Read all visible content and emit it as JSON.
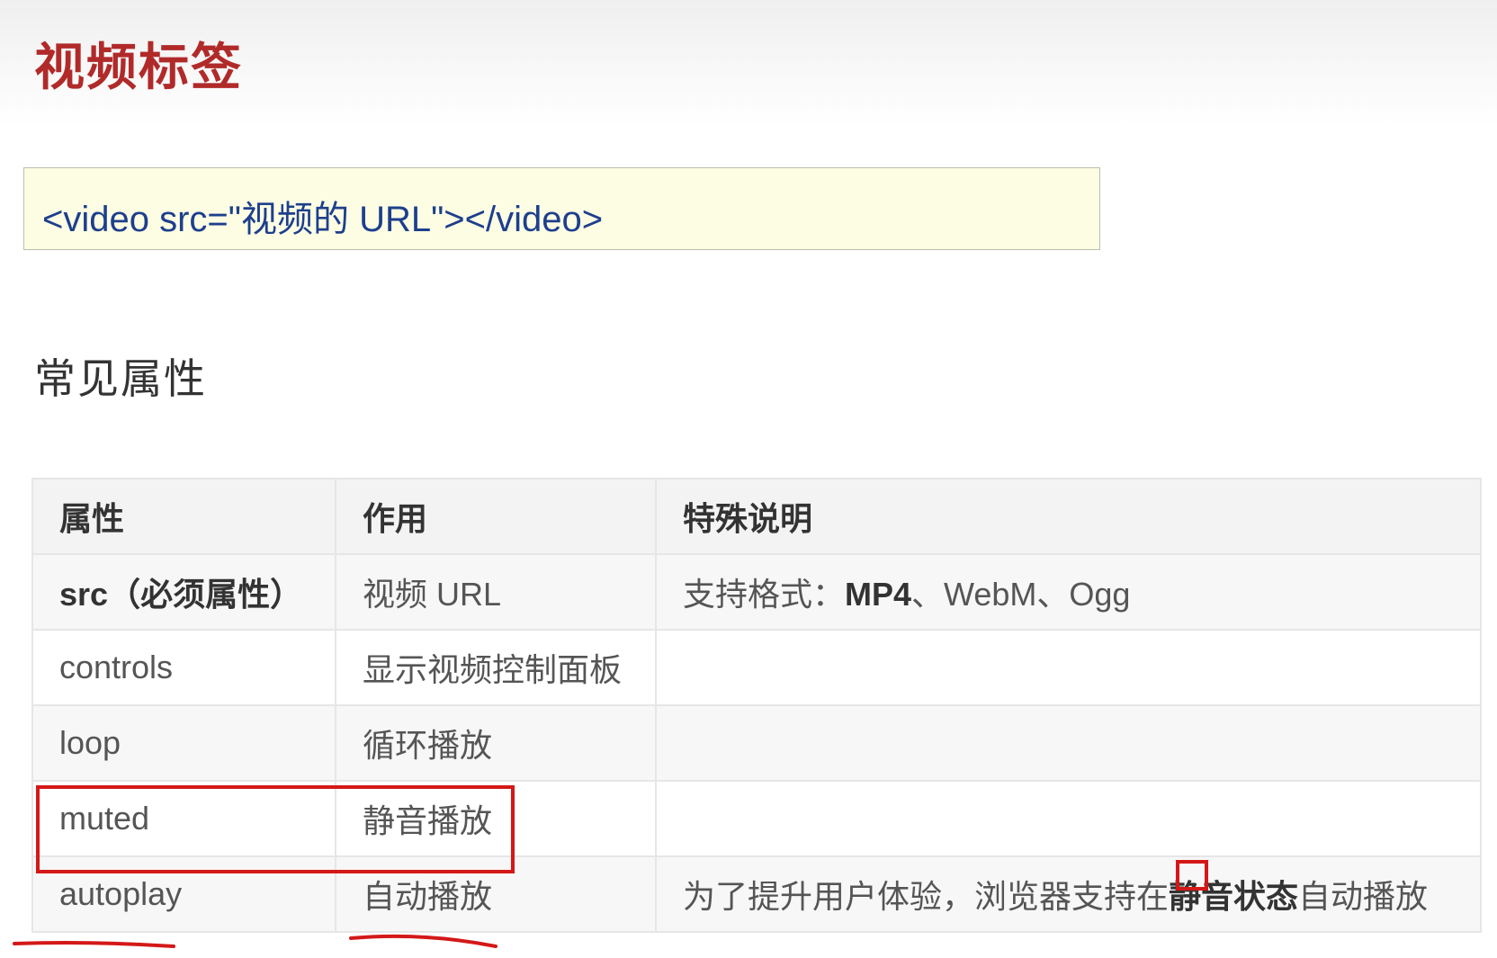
{
  "page": {
    "title": "视频标签",
    "code": "<video src=\"视频的 URL\"></video>",
    "subtitle": "常见属性"
  },
  "table": {
    "headers": [
      "属性",
      "作用",
      "特殊说明"
    ],
    "rows": [
      {
        "attr_name": "src",
        "attr_suffix": "（必须属性）",
        "purpose": "视频 URL",
        "note_prefix": "支持格式：",
        "note_bold": "MP4",
        "note_suffix": "、WebM、Ogg"
      },
      {
        "attr": "controls",
        "purpose": "显示视频控制面板",
        "note": ""
      },
      {
        "attr": "loop",
        "purpose": "循环播放",
        "note": ""
      },
      {
        "attr": "muted",
        "purpose": "静音播放",
        "note": ""
      },
      {
        "attr": "autoplay",
        "purpose": "自动播放",
        "note_prefix": "为了提升用户体验，浏览器支持在",
        "note_bold": "静音状态",
        "note_suffix": "自动播放"
      }
    ]
  },
  "colors": {
    "title": "#b12a2a",
    "code_text": "#1d3f8c",
    "code_background": "#fdfde4",
    "annotation": "#d41818"
  }
}
